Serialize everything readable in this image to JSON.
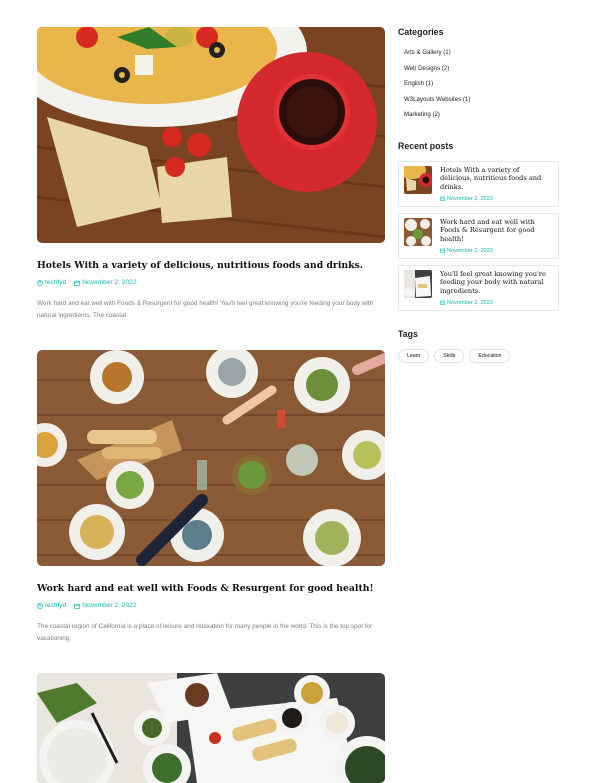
{
  "posts": [
    {
      "title": "Hotels With a variety of delicious, nutritious foods and drinks.",
      "author": "techfyd",
      "date": "November 2, 2022",
      "excerpt": "Work hard and eat well with Foods & Resurgent for good health! You'll feel great knowing you're feeding your body with natural ingredients. The coastal"
    },
    {
      "title": "Work hard and eat well with Foods & Resurgent for good health!",
      "author": "techfyd",
      "date": "November 2, 2022",
      "excerpt": "The coastal region of California is a place of leisure and relaxation for many people in the world. This is the top spot for vacationing."
    }
  ],
  "sidebar": {
    "categories_heading": "Categories",
    "categories": [
      "Arts & Gallery (1)",
      "Web Designs (2)",
      "English (1)",
      "W3Layouts Websites (1)",
      "Marketing (2)"
    ],
    "recent_heading": "Recent posts",
    "recent": [
      {
        "title": "Hotels With a variety of delicious, nutritious foods and drinks.",
        "date": "November 2, 2022"
      },
      {
        "title": "Work hard and eat well with Foods & Resurgent for good health!",
        "date": "November 2, 2022"
      },
      {
        "title": "You'll feel great knowing you're feeding your body with natural ingredients.",
        "date": "November 2, 2022"
      }
    ],
    "tags_heading": "Tags",
    "tags": [
      "Learn",
      "Skills",
      "Education"
    ]
  },
  "colors": {
    "accent": "#17b6b8",
    "text": "#111111",
    "muted": "#7a7f87"
  }
}
